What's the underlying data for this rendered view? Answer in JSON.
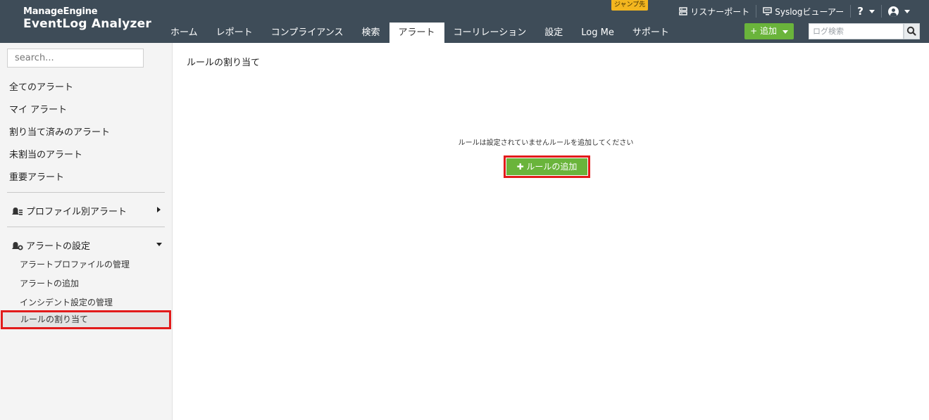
{
  "header": {
    "brand": "ManageEngine",
    "product": "EventLog Analyzer",
    "jump_badge": "ジャンプ先",
    "nav_tabs": [
      {
        "label": "ホーム"
      },
      {
        "label": "レポート"
      },
      {
        "label": "コンプライアンス"
      },
      {
        "label": "検索"
      },
      {
        "label": "アラート",
        "active": true
      },
      {
        "label": "コーリレーション"
      },
      {
        "label": "設定"
      },
      {
        "label": "Log Me"
      },
      {
        "label": "サポート"
      }
    ],
    "top_links": {
      "listener_port": "リスナーポート",
      "syslog_viewer": "Syslogビューアー",
      "help": "?"
    },
    "add_button": "+ 追加",
    "log_search_placeholder": "ログ検索"
  },
  "sidebar": {
    "search_placeholder": "search...",
    "items": [
      "全てのアラート",
      "マイ アラート",
      "割り当て済みのアラート",
      "未割当のアラート",
      "重要アラート"
    ],
    "profile_group": "プロファイル別アラート",
    "settings_group": "アラートの設定",
    "settings_items": [
      "アラートプロファイルの管理",
      "アラートの追加",
      "インシデント設定の管理",
      "ルールの割り当て"
    ]
  },
  "main": {
    "title": "ルールの割り当て",
    "empty_message": "ルールは設定されていませんルールを追加してください",
    "add_rule_button": "✚ ルールの追加"
  },
  "colors": {
    "header_bg": "#3e4c58",
    "green": "#6ab43b",
    "highlight_red": "#e21b1b",
    "badge_yellow": "#f3b61f"
  }
}
